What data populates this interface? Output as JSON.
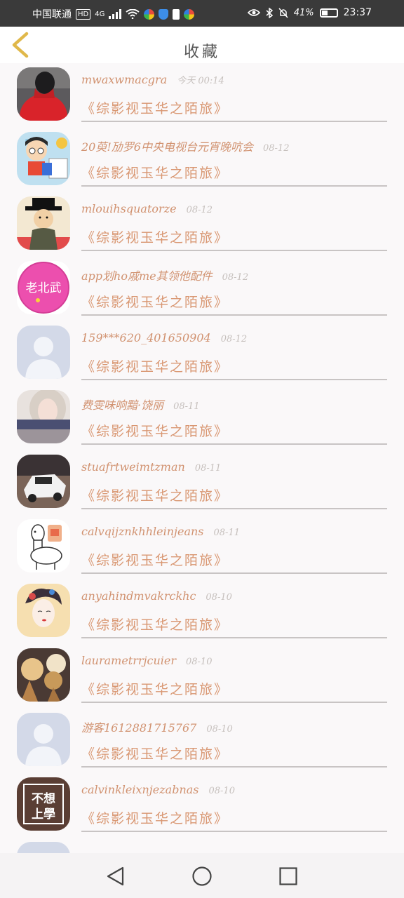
{
  "status_bar": {
    "carrier": "中国联通",
    "hd_badge": "HD",
    "network": "4G",
    "battery_percent": "41%",
    "battery_level": 0.41,
    "time": "23:37"
  },
  "header": {
    "title": "收藏",
    "back_icon": "chevron-left-icon"
  },
  "favorites": [
    {
      "username": "mwaxwmacgra",
      "date": "今天 00:14",
      "title": "《综影视玉华之陌旅》",
      "avatar": "red-hoodie"
    },
    {
      "username": "20萸!劢罗6中央电视台元宵晚吭会",
      "date": "08-12",
      "title": "《综影视玉华之陌旅》",
      "avatar": "cartoon-kids"
    },
    {
      "username": "mlouihsquatorze",
      "date": "08-12",
      "title": "《综影视玉华之陌旅》",
      "avatar": "man-hat"
    },
    {
      "username": "app划ho戚me其领他配件",
      "date": "08-12",
      "title": "《综影视玉华之陌旅》",
      "avatar": "pink-circle"
    },
    {
      "username": "159***620_401650904",
      "date": "08-12",
      "title": "《综影视玉华之陌旅》",
      "avatar": "default"
    },
    {
      "username": "费雯味响黯·饶丽",
      "date": "08-11",
      "title": "《综影视玉华之陌旅》",
      "avatar": "girl-photo"
    },
    {
      "username": "stuafrtweimtzman",
      "date": "08-11",
      "title": "《综影视玉华之陌旅》",
      "avatar": "white-car"
    },
    {
      "username": "calvqijznkhhleinjeans",
      "date": "08-11",
      "title": "《综影视玉华之陌旅》",
      "avatar": "alpaca"
    },
    {
      "username": "anyahindmvakrckhc",
      "date": "08-10",
      "title": "《综影视玉华之陌旅》",
      "avatar": "geisha"
    },
    {
      "username": "laurametrrjcuier",
      "date": "08-10",
      "title": "《综影视玉华之陌旅》",
      "avatar": "ice-cream"
    },
    {
      "username": "游客1612881715767",
      "date": "08-10",
      "title": "《综影视玉华之陌旅》",
      "avatar": "default"
    },
    {
      "username": "calvinkleixnjezabnas",
      "date": "08-10",
      "title": "《综影视玉华之陌旅》",
      "avatar": "buxiang-shangxue"
    }
  ],
  "avatar_texts": {
    "pink_circle": "老北武",
    "buxiang_1": "不想",
    "buxiang_2": "上學"
  },
  "navbar": {
    "back": "triangle-back-icon",
    "home": "circle-home-icon",
    "recents": "square-recents-icon"
  },
  "colors": {
    "accent": "#d99772",
    "date": "#c6c0bd",
    "divider": "#c8c4c4",
    "back_chevron": "#e0b84a"
  }
}
